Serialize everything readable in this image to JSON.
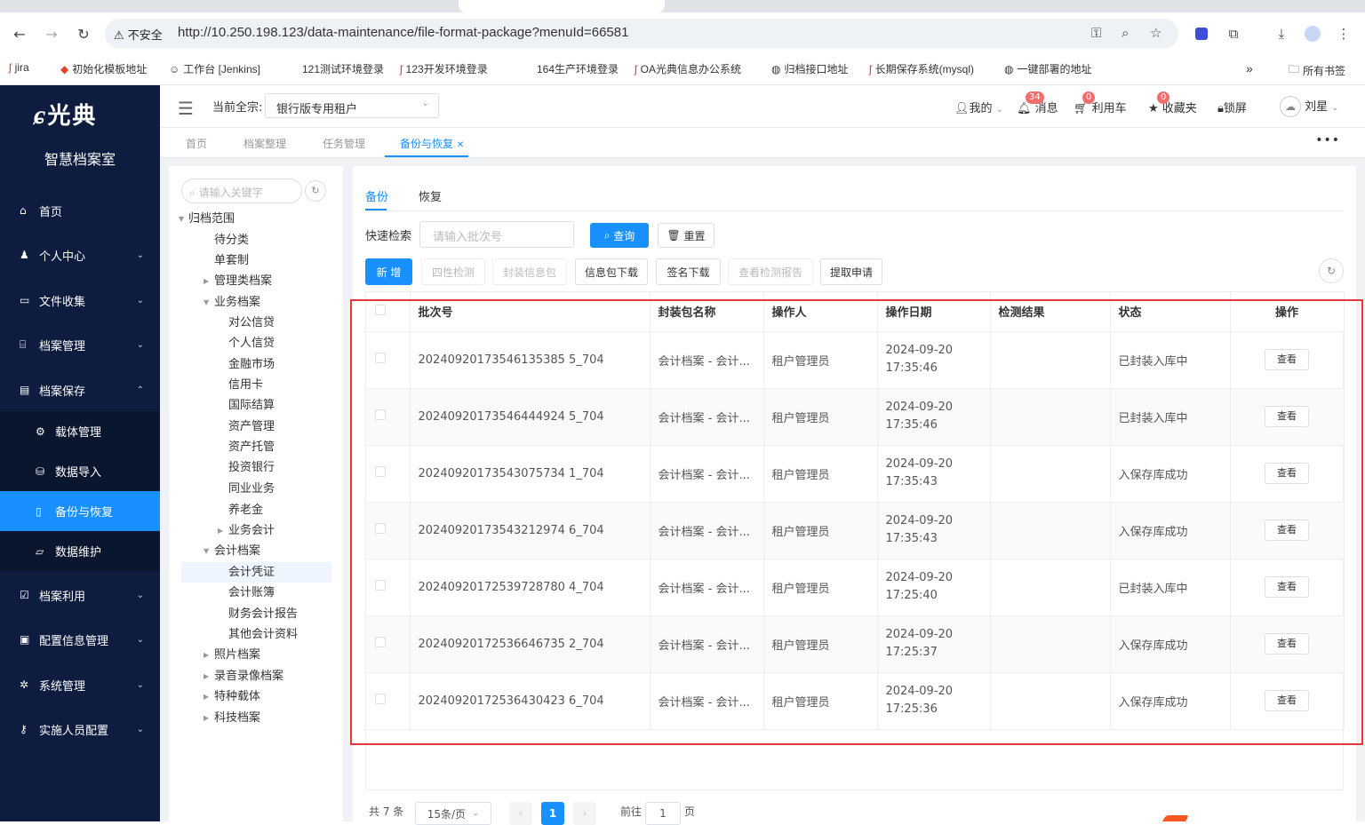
{
  "browser": {
    "security_label": "不安全",
    "url": "http://10.250.198.123/data-maintenance/file-format-package?menuId=66581",
    "bookmarks": [
      "jira",
      "初始化模板地址",
      "工作台 [Jenkins]",
      "121测试环境登录",
      "123开发环境登录",
      "164生产环境登录",
      "OA光典信息办公系统",
      "归档接口地址",
      "长期保存系统(mysql)",
      "一键部署的地址"
    ],
    "all_bookmarks": "所有书签"
  },
  "sidebar": {
    "logo": "光典",
    "subtitle": "智慧档案室",
    "items": [
      {
        "label": "首页",
        "icon": "home-icon"
      },
      {
        "label": "个人中心",
        "icon": "user-icon"
      },
      {
        "label": "文件收集",
        "icon": "inbox-icon"
      },
      {
        "label": "档案管理",
        "icon": "bank-icon"
      },
      {
        "label": "档案保存",
        "icon": "archive-icon"
      },
      {
        "label": "载体管理",
        "icon": "gear-icon"
      },
      {
        "label": "数据导入",
        "icon": "import-icon"
      },
      {
        "label": "备份与恢复",
        "icon": "backup-icon"
      },
      {
        "label": "数据维护",
        "icon": "folder-icon"
      },
      {
        "label": "档案利用",
        "icon": "check-doc-icon"
      },
      {
        "label": "配置信息管理",
        "icon": "clipboard-icon"
      },
      {
        "label": "系统管理",
        "icon": "settings-icon"
      },
      {
        "label": "实施人员配置",
        "icon": "key-icon"
      }
    ]
  },
  "header": {
    "tenant_label": "当前全宗:",
    "tenant_value": "银行版专用租户",
    "mine": "我的",
    "messages": "消息",
    "messages_count": "34",
    "cart": "利用车",
    "cart_count": "0",
    "favorites": "收藏夹",
    "favorites_count": "0",
    "lock": "锁屏",
    "user": "刘星"
  },
  "tags": [
    "首页",
    "档案整理",
    "任务管理",
    "备份与恢复"
  ],
  "tree": {
    "search_placeholder": "请输入关键字",
    "nodes": [
      "归档范围",
      "待分类",
      "单套制",
      "管理类档案",
      "业务档案",
      "对公信贷",
      "个人信贷",
      "金融市场",
      "信用卡",
      "国际结算",
      "资产管理",
      "资产托管",
      "投资银行",
      "同业业务",
      "养老金",
      "业务会计",
      "会计档案",
      "会计凭证",
      "会计账簿",
      "财务会计报告",
      "其他会计资料",
      "照片档案",
      "录音录像档案",
      "特种载体",
      "科技档案"
    ]
  },
  "content": {
    "tabs": [
      "备份",
      "恢复"
    ],
    "quick_search_label": "快速检索",
    "batch_placeholder": "请输入批次号",
    "query_btn": "查询",
    "reset_btn": "重置",
    "toolbar": [
      "新 增",
      "四性检测",
      "封装信息包",
      "信息包下载",
      "签名下载",
      "查看检测报告",
      "提取申请"
    ],
    "columns": [
      "批次号",
      "封装包名称",
      "操作人",
      "操作日期",
      "检测结果",
      "状态",
      "操作"
    ],
    "rows": [
      {
        "batch": "20240920173546135385 5_704",
        "pkg": "会计档案 - 会计...",
        "op": "租户管理员",
        "date": "2024-09-20 17:35:46",
        "result": "",
        "status": "已封装入库中",
        "action": "查看"
      },
      {
        "batch": "20240920173546444924 5_704",
        "pkg": "会计档案 - 会计...",
        "op": "租户管理员",
        "date": "2024-09-20 17:35:46",
        "result": "",
        "status": "已封装入库中",
        "action": "查看"
      },
      {
        "batch": "20240920173543075734 1_704",
        "pkg": "会计档案 - 会计...",
        "op": "租户管理员",
        "date": "2024-09-20 17:35:43",
        "result": "",
        "status": "入保存库成功",
        "action": "查看"
      },
      {
        "batch": "20240920173543212974 6_704",
        "pkg": "会计档案 - 会计...",
        "op": "租户管理员",
        "date": "2024-09-20 17:35:43",
        "result": "",
        "status": "入保存库成功",
        "action": "查看"
      },
      {
        "batch": "20240920172539728780 4_704",
        "pkg": "会计档案 - 会计...",
        "op": "租户管理员",
        "date": "2024-09-20 17:25:40",
        "result": "",
        "status": "已封装入库中",
        "action": "查看"
      },
      {
        "batch": "20240920172536646735 2_704",
        "pkg": "会计档案 - 会计...",
        "op": "租户管理员",
        "date": "2024-09-20 17:25:37",
        "result": "",
        "status": "入保存库成功",
        "action": "查看"
      },
      {
        "batch": "20240920172536430423 6_704",
        "pkg": "会计档案 - 会计...",
        "op": "租户管理员",
        "date": "2024-09-20 17:25:36",
        "result": "",
        "status": "入保存库成功",
        "action": "查看"
      }
    ],
    "pager": {
      "total": "共 7 条",
      "page_size": "15条/页",
      "current": "1",
      "goto_label": "前往",
      "goto_value": "1",
      "page_suffix": "页"
    }
  }
}
